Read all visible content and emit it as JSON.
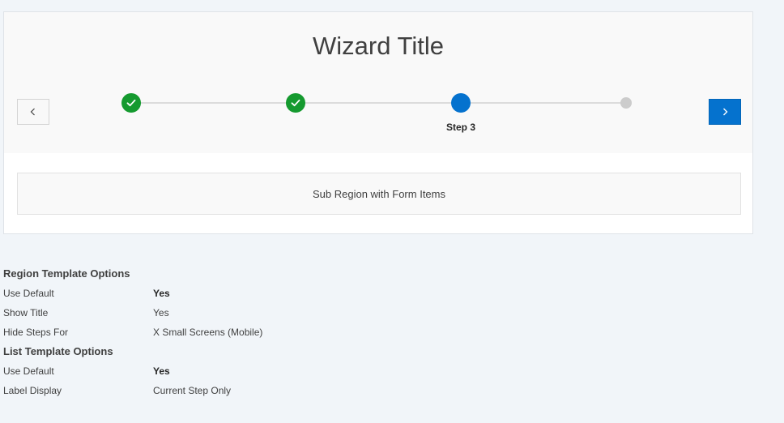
{
  "wizard": {
    "title": "Wizard Title",
    "prev_icon": "chevron-left-icon",
    "next_icon": "chevron-right-icon",
    "steps": [
      {
        "status": "complete",
        "icon": "check-icon"
      },
      {
        "status": "complete",
        "icon": "check-icon"
      },
      {
        "status": "current",
        "label": "Step 3"
      },
      {
        "status": "upcoming"
      }
    ],
    "colors": {
      "complete": "#159a2f",
      "current": "#0572ce",
      "upcoming": "#cccccc",
      "next_button": "#0572ce"
    },
    "sub_region": "Sub Region with Form Items"
  },
  "region_options": {
    "heading": "Region Template Options",
    "rows": [
      {
        "key": "Use Default",
        "value": "Yes"
      },
      {
        "key": "Show Title",
        "value": "Yes"
      },
      {
        "key": "Hide Steps For",
        "value": "X Small Screens (Mobile)"
      }
    ]
  },
  "list_options": {
    "heading": "List Template Options",
    "rows": [
      {
        "key": "Use Default",
        "value": "Yes"
      },
      {
        "key": "Label Display",
        "value": "Current Step Only"
      }
    ]
  }
}
